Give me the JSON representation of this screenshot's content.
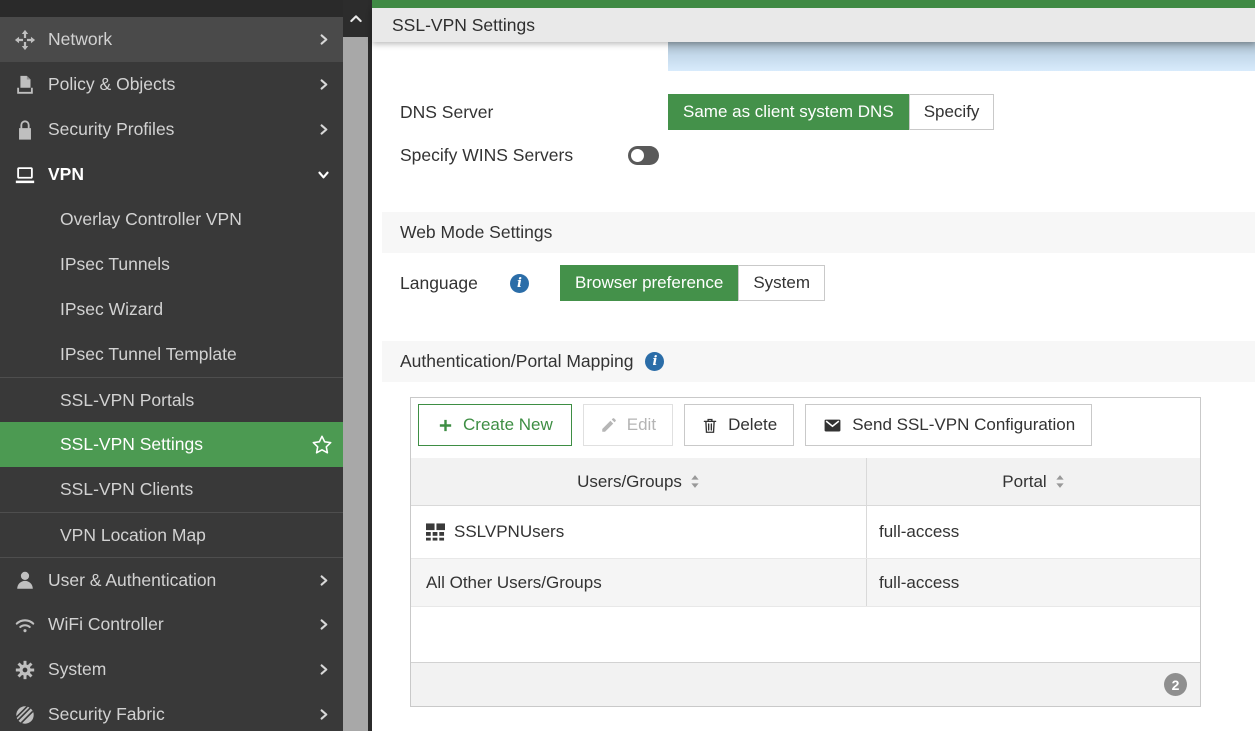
{
  "colors": {
    "accent_green": "#44914a",
    "sidebar_selected_green": "#4c9a52",
    "info_blue": "#2b6da8",
    "badge_gray": "#8f8f8f"
  },
  "titlebar": {
    "title": "SSL-VPN Settings"
  },
  "sidebar": {
    "items": [
      {
        "label": "Network"
      },
      {
        "label": "Policy & Objects"
      },
      {
        "label": "Security Profiles"
      },
      {
        "label": "VPN"
      },
      {
        "label": "Overlay Controller VPN"
      },
      {
        "label": "IPsec Tunnels"
      },
      {
        "label": "IPsec Wizard"
      },
      {
        "label": "IPsec Tunnel Template"
      },
      {
        "label": "SSL-VPN Portals"
      },
      {
        "label": "SSL-VPN Settings"
      },
      {
        "label": "SSL-VPN Clients"
      },
      {
        "label": "VPN Location Map"
      },
      {
        "label": "User & Authentication"
      },
      {
        "label": "WiFi Controller"
      },
      {
        "label": "System"
      },
      {
        "label": "Security Fabric"
      }
    ]
  },
  "tunnel_mode": {
    "dns_server_label": "DNS Server",
    "dns_option_same": "Same as client system DNS",
    "dns_option_specify": "Specify",
    "wins_label": "Specify WINS Servers"
  },
  "web_mode": {
    "heading": "Web Mode Settings",
    "language_label": "Language",
    "language_option_browser": "Browser preference",
    "language_option_system": "System"
  },
  "portal_mapping": {
    "heading": "Authentication/Portal Mapping",
    "toolbar": {
      "create_label": "Create New",
      "edit_label": "Edit",
      "delete_label": "Delete",
      "send_label": "Send SSL-VPN Configuration"
    },
    "table": {
      "col_users": "Users/Groups",
      "col_portal": "Portal",
      "rows": [
        {
          "users_groups": "SSLVPNUsers",
          "portal": "full-access"
        },
        {
          "users_groups": "All Other Users/Groups",
          "portal": "full-access"
        }
      ],
      "count": "2"
    }
  }
}
